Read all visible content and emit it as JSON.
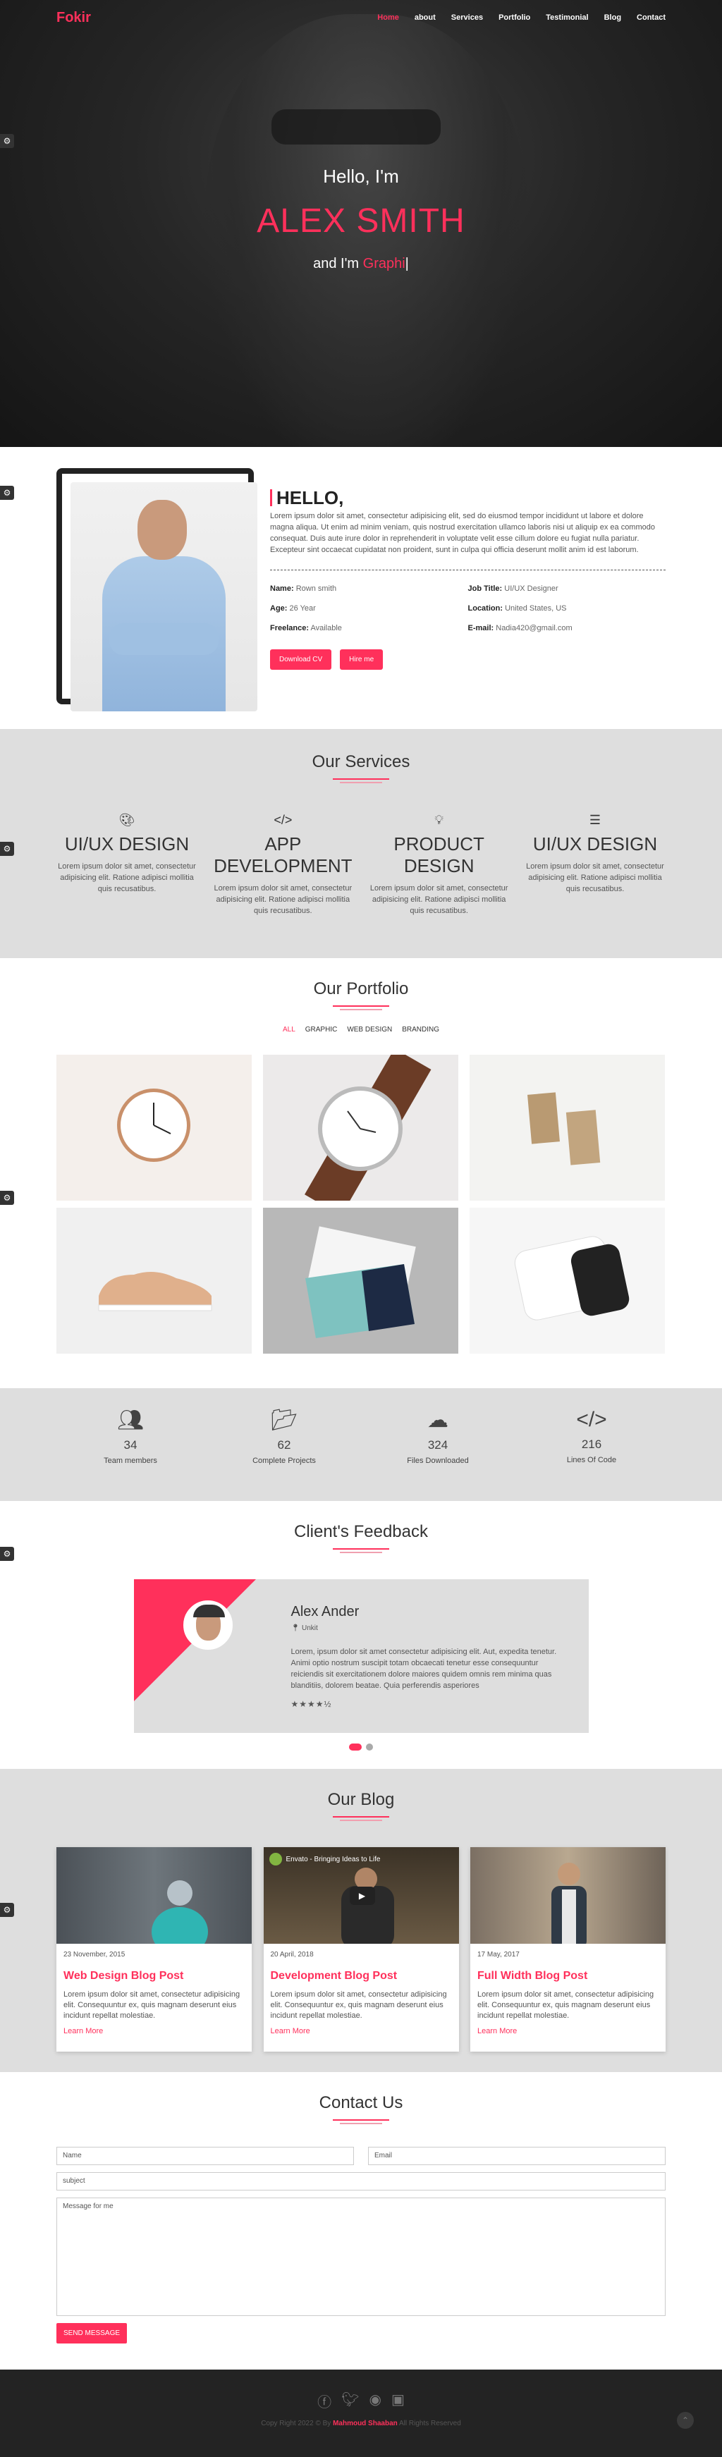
{
  "nav": {
    "logo": "Fokir",
    "items": [
      "Home",
      "about",
      "Services",
      "Portfolio",
      "Testimonial",
      "Blog",
      "Contact"
    ]
  },
  "hero": {
    "hello": "Hello, I'm",
    "name": "ALEX SMITH",
    "role_prefix": "and I'm",
    "role_typed": "Graphi"
  },
  "about": {
    "title": "HELLO,",
    "description": "Lorem ipsum dolor sit amet, consectetur adipisicing elit, sed do eiusmod tempor incididunt ut labore et dolore magna aliqua. Ut enim ad minim veniam, quis nostrud exercitation ullamco laboris nisi ut aliquip ex ea commodo consequat. Duis aute irure dolor in reprehenderit in voluptate velit esse cillum dolore eu fugiat nulla pariatur. Excepteur sint occaecat cupidatat non proident, sunt in culpa qui officia deserunt mollit anim id est laborum.",
    "info": [
      {
        "label": "Name:",
        "value": "Rown smith"
      },
      {
        "label": "Job Title:",
        "value": "UI/UX Designer"
      },
      {
        "label": "Age:",
        "value": "26 Year"
      },
      {
        "label": "Location:",
        "value": "United States, US"
      },
      {
        "label": "Freelance:",
        "value": "Available"
      },
      {
        "label": "E-mail:",
        "value": "Nadia420@gmail.com"
      }
    ],
    "download_label": "Download CV",
    "hire_label": "Hire me"
  },
  "services": {
    "title": "Our Services",
    "items": [
      {
        "icon": "palette-icon",
        "title": "UI/UX DESIGN",
        "text": "Lorem ipsum dolor sit amet, consectetur adipisicing elit. Ratione adipisci mollitia quis recusatibus."
      },
      {
        "icon": "code-icon",
        "title": "APP DEVELOPMENT",
        "text": "Lorem ipsum dolor sit amet, consectetur adipisicing elit. Ratione adipisci mollitia quis recusatibus."
      },
      {
        "icon": "lightbulb-icon",
        "title": "PRODUCT DESIGN",
        "text": "Lorem ipsum dolor sit amet, consectetur adipisicing elit. Ratione adipisci mollitia quis recusatibus."
      },
      {
        "icon": "sliders-icon",
        "title": "UI/UX DESIGN",
        "text": "Lorem ipsum dolor sit amet, consectetur adipisicing elit. Ratione adipisci mollitia quis recusatibus."
      }
    ]
  },
  "portfolio": {
    "title": "Our Portfolio",
    "filters": [
      "ALL",
      "GRAPHIC",
      "WEB DESIGN",
      "BRANDING"
    ]
  },
  "stats": [
    {
      "icon": "users-icon",
      "num": "34",
      "label": "Team members"
    },
    {
      "icon": "folder-icon",
      "num": "62",
      "label": "Complete Projects"
    },
    {
      "icon": "cloud-download-icon",
      "num": "324",
      "label": "Files Downloaded"
    },
    {
      "icon": "code-icon",
      "num": "216",
      "label": "Lines Of Code"
    }
  ],
  "feedback": {
    "title": "Client's Feedback",
    "name": "Alex Ander",
    "location": "Unkit",
    "text": "Lorem, ipsum dolor sit amet consectetur adipisicing elit. Aut, expedita tenetur. Animi optio nostrum suscipit totam obcaecati tenetur esse consequuntur reiciendis sit exercitationem dolore maiores quidem omnis rem minima quas blanditiis, dolorem beatae. Quia perferendis asperiores",
    "stars": "★★★★½"
  },
  "blog": {
    "title": "Our Blog",
    "video_title": "Envato - Bringing Ideas to Life",
    "posts": [
      {
        "date": "23 November, 2015",
        "title": "Web Design Blog Post",
        "text": "Lorem ipsum dolor sit amet, consectetur adipisicing elit. Consequuntur ex, quis magnam deserunt eius incidunt repellat molestiae.",
        "more": "Learn More"
      },
      {
        "date": "20 April, 2018",
        "title": "Development Blog Post",
        "text": "Lorem ipsum dolor sit amet, consectetur adipisicing elit. Consequuntur ex, quis magnam deserunt eius incidunt repellat molestiae.",
        "more": "Learn More"
      },
      {
        "date": "17 May, 2017",
        "title": "Full Width Blog Post",
        "text": "Lorem ipsum dolor sit amet, consectetur adipisicing elit. Consequuntur ex, quis magnam deserunt eius incidunt repellat molestiae.",
        "more": "Learn More"
      }
    ]
  },
  "contact": {
    "title": "Contact Us",
    "name_placeholder": "Name",
    "email_placeholder": "Email",
    "subject_placeholder": "subject",
    "message_placeholder": "Message for me",
    "send_label": "SEND MESSAGE"
  },
  "footer": {
    "copy_prefix": "Copy Right 2022 © By",
    "author": "Mahmoud Shaaban",
    "copy_suffix": "All Rights Reserved"
  },
  "colors": {
    "accent": "#ff305b",
    "dark": "#232323",
    "gray": "#dedede"
  }
}
